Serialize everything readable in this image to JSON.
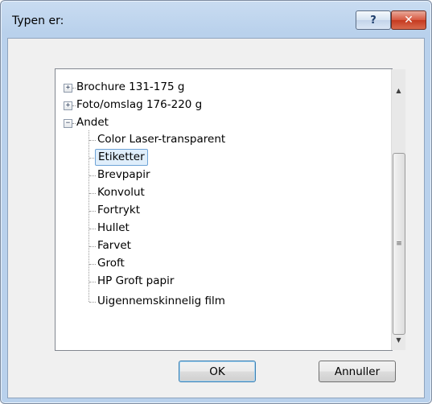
{
  "window": {
    "title": "Typen er:",
    "help_icon_label": "?",
    "close_icon_label": "✕"
  },
  "tree": {
    "groups": [
      {
        "label": "Brochure 131-175 g",
        "expanded": false
      },
      {
        "label": "Foto/omslag 176-220 g",
        "expanded": false
      },
      {
        "label": "Andet",
        "expanded": true
      }
    ],
    "children": [
      {
        "label": "Color Laser-transparent"
      },
      {
        "label": "Etiketter",
        "selected": true
      },
      {
        "label": "Brevpapir"
      },
      {
        "label": "Konvolut"
      },
      {
        "label": "Fortrykt"
      },
      {
        "label": "Hullet"
      },
      {
        "label": "Farvet"
      },
      {
        "label": "Groft"
      },
      {
        "label": "HP Groft papir"
      },
      {
        "label": "Uigennemskinnelig film"
      }
    ]
  },
  "buttons": {
    "ok": "OK",
    "cancel": "Annuller"
  }
}
